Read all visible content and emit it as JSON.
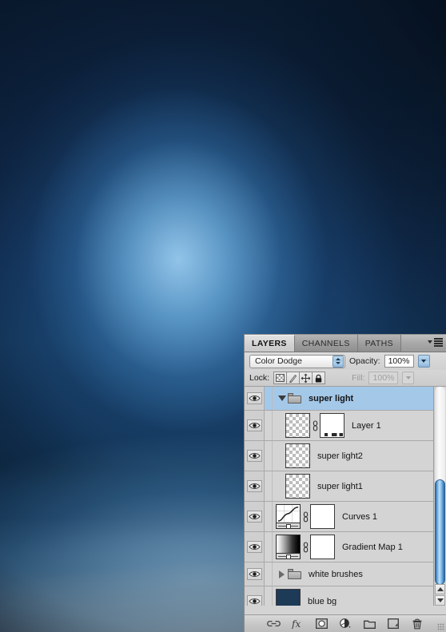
{
  "canvas": {
    "name": "photoshop-canvas",
    "description": "blue radial glow artwork",
    "colors": {
      "deep_navy": "#0c1f37",
      "mid_blue": "#15395f",
      "glow_blue": "#96c8ec",
      "haze_white": "#bcdcf1"
    }
  },
  "panel": {
    "title": "Layers",
    "tabs": [
      {
        "label": "LAYERS",
        "active": true
      },
      {
        "label": "CHANNELS",
        "active": false
      },
      {
        "label": "PATHS",
        "active": false
      }
    ],
    "menu_icon": "panel-menu-icon",
    "blend": {
      "mode": "Color Dodge",
      "opacity_label": "Opacity:",
      "opacity_value": "100%"
    },
    "lock": {
      "label": "Lock:",
      "buttons": [
        {
          "name": "lock-transparent-pixels",
          "icon": "checkerboard-icon",
          "active": false
        },
        {
          "name": "lock-image-pixels",
          "icon": "brush-icon",
          "active": false
        },
        {
          "name": "lock-position",
          "icon": "move-icon",
          "active": false
        },
        {
          "name": "lock-all",
          "icon": "lock-icon",
          "active": true
        }
      ],
      "fill_label": "Fill:",
      "fill_value": "100%"
    },
    "layers": [
      {
        "name": "super light",
        "type": "group",
        "selected": true,
        "expanded": true,
        "visible": true,
        "thumb": "folder",
        "indent": 0
      },
      {
        "name": "Layer 1",
        "type": "pixel",
        "selected": false,
        "visible": true,
        "thumb": "checker",
        "has_mask": true,
        "linked": true,
        "indent": 1
      },
      {
        "name": "super light2",
        "type": "pixel",
        "selected": false,
        "visible": true,
        "thumb": "checker",
        "has_mask": false,
        "indent": 1
      },
      {
        "name": "super light1",
        "type": "pixel",
        "selected": false,
        "visible": true,
        "thumb": "checker",
        "has_mask": false,
        "indent": 1
      },
      {
        "name": "Curves 1",
        "type": "adjustment",
        "selected": false,
        "visible": true,
        "thumb": "curves",
        "has_mask": true,
        "linked": true,
        "indent": 0
      },
      {
        "name": "Gradient Map 1",
        "type": "adjustment",
        "selected": false,
        "visible": true,
        "thumb": "gradient-map",
        "has_mask": true,
        "linked": true,
        "indent": 0
      },
      {
        "name": "white brushes",
        "type": "group",
        "selected": false,
        "expanded": false,
        "visible": true,
        "thumb": "folder",
        "indent": 0
      },
      {
        "name": "blue bg",
        "type": "pixel",
        "selected": false,
        "visible": true,
        "thumb": "solid",
        "thumb_color": "#1d3a57",
        "indent": 0
      }
    ],
    "scrollbar": {
      "name": "layers-scrollbar",
      "thumb_color": "#5ea3db"
    },
    "footer_buttons": [
      {
        "name": "link-layers-button",
        "icon": "chain-icon"
      },
      {
        "name": "add-layer-style-button",
        "icon": "fx-icon"
      },
      {
        "name": "add-layer-mask-button",
        "icon": "mask-icon"
      },
      {
        "name": "new-adjustment-layer-button",
        "icon": "half-circle-icon"
      },
      {
        "name": "new-group-button",
        "icon": "folder-icon"
      },
      {
        "name": "new-layer-button",
        "icon": "new-layer-icon"
      },
      {
        "name": "delete-layer-button",
        "icon": "trash-icon"
      }
    ]
  }
}
